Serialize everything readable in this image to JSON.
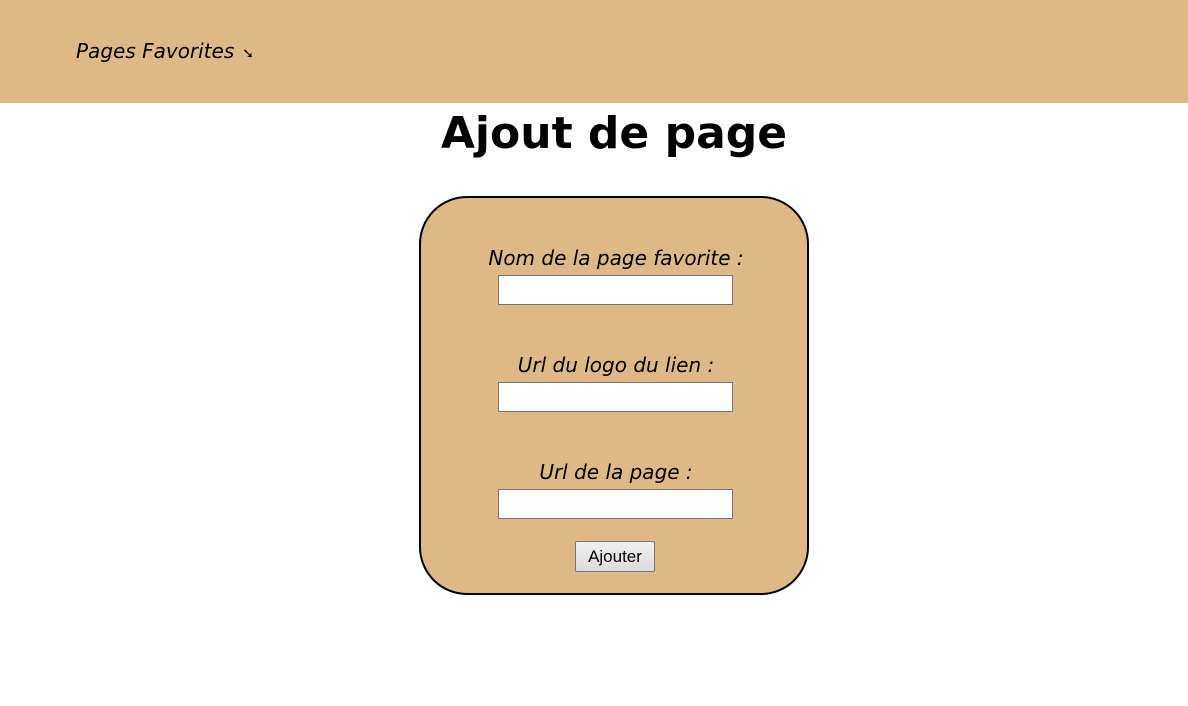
{
  "header": {
    "nav_link_label": "Pages Favorites",
    "nav_arrow_glyph": "➘",
    "background_color": "#deb887"
  },
  "main": {
    "title": "Ajout de page"
  },
  "form": {
    "card_color": "#deb887",
    "fields": [
      {
        "label": "Nom de la page favorite :",
        "value": ""
      },
      {
        "label": "Url du logo du lien :",
        "value": ""
      },
      {
        "label": "Url de la page :",
        "value": ""
      }
    ],
    "submit_label": "Ajouter"
  }
}
